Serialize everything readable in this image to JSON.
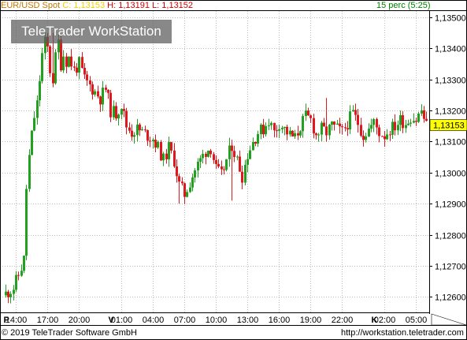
{
  "header": {
    "symbol": "EUR/USD Spot",
    "close_label": "C: 1,13153",
    "high_label": "H: 1,13191",
    "low_label": "L: 1,13152",
    "interval": "15 perc (5:25)"
  },
  "watermark": "TeleTrader WorkStation",
  "last_price_label": "1,13153",
  "footer": {
    "copyright": "© 2019 TeleTrader Software GmbH",
    "url": "http://workstation.teletrader.com"
  },
  "colors": {
    "up": "#22a020",
    "down": "#e0181c",
    "grid": "#bdbdbd",
    "last_price_bg": "#ffff00",
    "symbol_text": "#c07800",
    "close_text": "#f0d000",
    "hl_text": "#d00000",
    "interval_text": "#008000"
  },
  "chart_data": {
    "type": "candlestick",
    "title": "EUR/USD Spot",
    "ylim": [
      1.1255,
      1.1352
    ],
    "y_ticks": [
      "1,13500",
      "1,13400",
      "1,13300",
      "1,13200",
      "1,13100",
      "1,13000",
      "1,12900",
      "1,12800",
      "1,12700",
      "1,12600"
    ],
    "y_tick_values": [
      1.135,
      1.134,
      1.133,
      1.132,
      1.131,
      1.13,
      1.129,
      1.128,
      1.127,
      1.126
    ],
    "x_tick_labels": [
      "P",
      "14:00",
      "17:00",
      "20:00",
      "V",
      "01:00",
      "04:00",
      "07:00",
      "10:00",
      "13:00",
      "16:00",
      "19:00",
      "22:00",
      "K",
      "02:00",
      "05:00"
    ],
    "x_tick_bars": [
      0,
      4,
      16,
      28,
      40,
      44,
      56,
      68,
      80,
      92,
      104,
      116,
      128,
      140,
      144,
      156
    ],
    "x_tick_is_day": [
      true,
      false,
      false,
      false,
      true,
      false,
      false,
      false,
      false,
      false,
      false,
      false,
      false,
      true,
      false,
      false
    ],
    "grid": true,
    "last_price": 1.13153,
    "close_points": [
      [
        0,
        1.1261
      ],
      [
        3,
        1.1263
      ],
      [
        5,
        1.1267
      ],
      [
        7,
        1.1272
      ],
      [
        8,
        1.1295
      ],
      [
        9,
        1.1305
      ],
      [
        10,
        1.1312
      ],
      [
        11,
        1.1318
      ],
      [
        12,
        1.1322
      ],
      [
        13,
        1.133
      ],
      [
        14,
        1.1338
      ],
      [
        15,
        1.1342
      ],
      [
        16,
        1.134
      ],
      [
        17,
        1.1333
      ],
      [
        18,
        1.133
      ],
      [
        19,
        1.1337
      ],
      [
        20,
        1.1342
      ],
      [
        21,
        1.1335
      ],
      [
        22,
        1.1338
      ],
      [
        23,
        1.1336
      ],
      [
        24,
        1.1337
      ],
      [
        26,
        1.1333
      ],
      [
        28,
        1.1335
      ],
      [
        30,
        1.133
      ],
      [
        32,
        1.1328
      ],
      [
        34,
        1.1326
      ],
      [
        36,
        1.1324
      ],
      [
        38,
        1.1327
      ],
      [
        40,
        1.132
      ],
      [
        42,
        1.1319
      ],
      [
        44,
        1.1322
      ],
      [
        46,
        1.1315
      ],
      [
        48,
        1.1313
      ],
      [
        50,
        1.1314
      ],
      [
        52,
        1.1313
      ],
      [
        54,
        1.1312
      ],
      [
        56,
        1.1311
      ],
      [
        58,
        1.1308
      ],
      [
        60,
        1.1304
      ],
      [
        62,
        1.1308
      ],
      [
        64,
        1.1304
      ],
      [
        66,
        1.1296
      ],
      [
        68,
        1.1293
      ],
      [
        70,
        1.1297
      ],
      [
        72,
        1.1301
      ],
      [
        74,
        1.1304
      ],
      [
        76,
        1.1307
      ],
      [
        78,
        1.1308
      ],
      [
        80,
        1.1301
      ],
      [
        82,
        1.1299
      ],
      [
        84,
        1.1304
      ],
      [
        86,
        1.1309
      ],
      [
        88,
        1.1304
      ],
      [
        90,
        1.1299
      ],
      [
        92,
        1.1306
      ],
      [
        94,
        1.131
      ],
      [
        96,
        1.1313
      ],
      [
        98,
        1.1314
      ],
      [
        100,
        1.1317
      ],
      [
        102,
        1.1313
      ],
      [
        104,
        1.1316
      ],
      [
        106,
        1.1314
      ],
      [
        108,
        1.1312
      ],
      [
        110,
        1.1311
      ],
      [
        112,
        1.1315
      ],
      [
        114,
        1.1318
      ],
      [
        116,
        1.1317
      ],
      [
        118,
        1.1312
      ],
      [
        120,
        1.1314
      ],
      [
        122,
        1.1313
      ],
      [
        124,
        1.1315
      ],
      [
        126,
        1.1314
      ],
      [
        128,
        1.1313
      ],
      [
        130,
        1.1316
      ],
      [
        132,
        1.1319
      ],
      [
        134,
        1.1316
      ],
      [
        136,
        1.1312
      ],
      [
        138,
        1.1314
      ],
      [
        140,
        1.1316
      ],
      [
        142,
        1.1313
      ],
      [
        144,
        1.1312
      ],
      [
        146,
        1.1314
      ],
      [
        148,
        1.1315
      ],
      [
        150,
        1.1317
      ],
      [
        152,
        1.1316
      ],
      [
        154,
        1.1318
      ],
      [
        156,
        1.1317
      ],
      [
        158,
        1.132
      ],
      [
        160,
        1.1315
      ]
    ]
  }
}
